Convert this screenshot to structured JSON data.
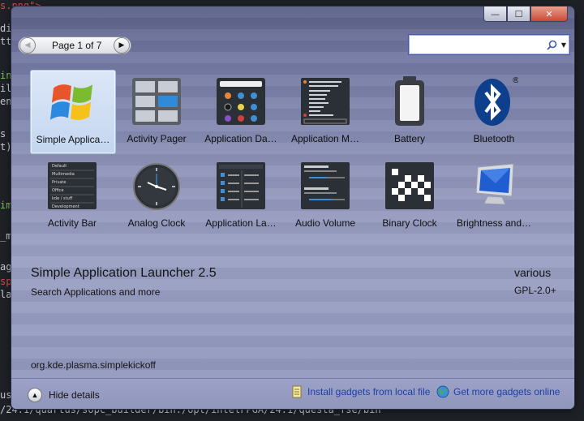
{
  "terminal": {
    "lines": [
      {
        "text": "s.png\">",
        "cls": "r"
      },
      {
        "text": "di",
        "cls": ""
      },
      {
        "text": "tt",
        "cls": ""
      },
      {
        "text": "in",
        "cls": "g"
      },
      {
        "text": "il",
        "cls": ""
      },
      {
        "text": "en",
        "cls": ""
      },
      {
        "text": "s",
        "cls": ""
      },
      {
        "text": "t)",
        "cls": ""
      },
      {
        "text": "im",
        "cls": "g"
      },
      {
        "text": "_m",
        "cls": ""
      },
      {
        "text": "ag",
        "cls": ""
      },
      {
        "text": "sp",
        "cls": "r"
      },
      {
        "text": "la",
        "cls": ""
      },
      {
        "text": "us",
        "cls": ""
      },
      {
        "text": "/24.1/quartus/sopc_builder/bin:/opt/intelFPGA/24.1/questa_fse/bin",
        "cls": ""
      }
    ]
  },
  "window": {
    "buttons": {
      "minimize": "—",
      "maximize": "☐",
      "close": "✕"
    }
  },
  "pager": {
    "label": "Page 1 of 7",
    "prev_icon": "chevron-left-icon",
    "next_icon": "chevron-right-icon"
  },
  "search": {
    "value": "",
    "placeholder": "",
    "icon": "magnifier-icon"
  },
  "widgets": [
    {
      "label": "Simple Applica…",
      "icon": "windows-logo-icon",
      "selected": true
    },
    {
      "label": "Activity Pager",
      "icon": "pager-grid-icon",
      "selected": false
    },
    {
      "label": "Application Da…",
      "icon": "dashboard-icon",
      "selected": false
    },
    {
      "label": "Application M…",
      "icon": "app-menu-icon",
      "selected": false
    },
    {
      "label": "Battery",
      "icon": "battery-icon",
      "selected": false
    },
    {
      "label": "Bluetooth",
      "icon": "bluetooth-icon",
      "selected": false
    },
    {
      "label": "Activity Bar",
      "icon": "activity-bar-icon",
      "selected": false
    },
    {
      "label": "Analog Clock",
      "icon": "analog-clock-icon",
      "selected": false
    },
    {
      "label": "Application La…",
      "icon": "app-launcher-icon",
      "selected": false
    },
    {
      "label": "Audio Volume",
      "icon": "audio-volume-icon",
      "selected": false
    },
    {
      "label": "Binary Clock",
      "icon": "binary-clock-icon",
      "selected": false
    },
    {
      "label": "Brightness and…",
      "icon": "monitor-icon",
      "selected": false
    }
  ],
  "activity_bar_items": [
    "Default",
    "Multimedia",
    "Private",
    "Office",
    "kde / stuff",
    "Development"
  ],
  "details": {
    "name": "Simple Application Launcher 2.5",
    "description": "Search Applications and more",
    "author": "various",
    "license": "GPL-2.0+",
    "plugin_id": "org.kde.plasma.simplekickoff"
  },
  "footer": {
    "hide_details": "Hide details",
    "install_local": "Install gadgets from local file",
    "get_more": "Get more gadgets online"
  },
  "colors": {
    "link": "#1d3fa8",
    "selection": "#c4d6f0",
    "window_tint": "#8e93b9"
  }
}
